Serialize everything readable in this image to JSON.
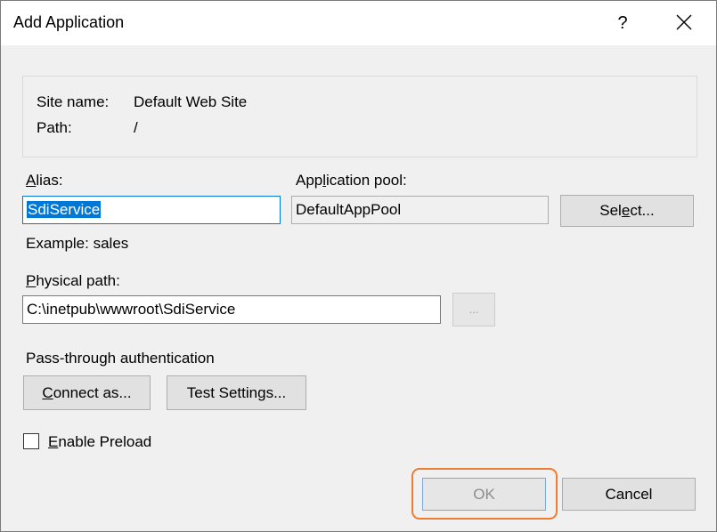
{
  "window": {
    "title": "Add Application",
    "help_label": "?"
  },
  "info": {
    "site_name_label": "Site name:",
    "site_name_value": "Default Web Site",
    "path_label": "Path:",
    "path_value": "/"
  },
  "alias": {
    "label_mnemonic": "A",
    "label_rest": "lias:",
    "value": "SdiService",
    "example": "Example: sales"
  },
  "app_pool": {
    "label_pre": "App",
    "label_mnemonic": "l",
    "label_post": "ication pool:",
    "value": "DefaultAppPool",
    "select_pre": "Sel",
    "select_mnemonic": "e",
    "select_post": "ct..."
  },
  "physical_path": {
    "label_mnemonic": "P",
    "label_rest": "hysical path:",
    "value": "C:\\inetpub\\wwwroot\\SdiService",
    "browse_label": "..."
  },
  "auth": {
    "label": "Pass-through authentication",
    "connect_mnemonic": "C",
    "connect_rest": "onnect as...",
    "test_pre": "Test Settin",
    "test_mnemonic": "g",
    "test_post": "s..."
  },
  "preload": {
    "label_mnemonic": "E",
    "label_rest": "nable Preload",
    "checked": false
  },
  "footer": {
    "ok_label": "OK",
    "cancel_label": "Cancel"
  },
  "colors": {
    "selection": "#0078d7",
    "highlight": "#ed7d31"
  }
}
